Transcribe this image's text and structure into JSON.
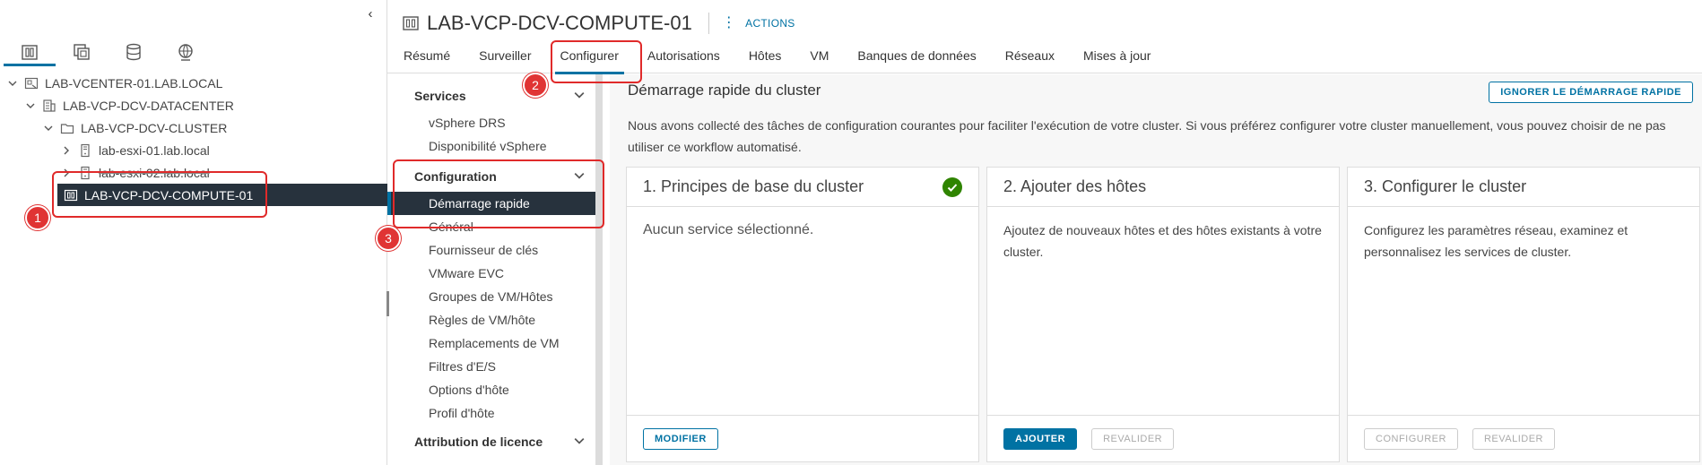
{
  "navigator": {
    "collapse_glyph": "‹",
    "view_tabs": [
      {
        "icon": "hosts-clusters-icon"
      },
      {
        "icon": "vms-templates-icon"
      },
      {
        "icon": "storage-icon"
      },
      {
        "icon": "networking-icon"
      }
    ],
    "tree": [
      {
        "label": "LAB-VCENTER-01.LAB.LOCAL",
        "icon": "vcenter-icon",
        "expanded": true
      },
      {
        "label": "LAB-VCP-DCV-DATACENTER",
        "icon": "datacenter-icon",
        "expanded": true
      },
      {
        "label": "LAB-VCP-DCV-CLUSTER",
        "icon": "folder-icon",
        "expanded": true
      },
      {
        "label": "lab-esxi-01.lab.local",
        "icon": "host-icon",
        "expanded": false
      },
      {
        "label": "lab-esxi-02.lab.local",
        "icon": "host-icon",
        "expanded": false
      },
      {
        "label": "LAB-VCP-DCV-COMPUTE-01",
        "icon": "cluster-icon",
        "selected": true
      }
    ]
  },
  "annotations": {
    "m1": "1",
    "m2": "2",
    "m3": "3"
  },
  "header": {
    "title": "LAB-VCP-DCV-COMPUTE-01",
    "actions_label": "ACTIONS",
    "tabs": [
      "Résumé",
      "Surveiller",
      "Configurer",
      "Autorisations",
      "Hôtes",
      "VM",
      "Banques de données",
      "Réseaux",
      "Mises à jour"
    ],
    "active_tab": "Configurer"
  },
  "subnav": {
    "services": {
      "title": "Services",
      "items": [
        "vSphere DRS",
        "Disponibilité vSphere"
      ]
    },
    "configuration": {
      "title": "Configuration",
      "items": [
        "Démarrage rapide",
        "Général",
        "Fournisseur de clés",
        "VMware EVC",
        "Groupes de VM/Hôtes",
        "Règles de VM/hôte",
        "Remplacements de VM",
        "Filtres d'E/S",
        "Options d'hôte",
        "Profil d'hôte"
      ]
    },
    "licensing": {
      "title": "Attribution de licence"
    }
  },
  "main": {
    "title": "Démarrage rapide du cluster",
    "ignore_button": "IGNORER LE DÉMARRAGE RAPIDE",
    "description": "Nous avons collecté des tâches de configuration courantes pour faciliter l'exécution de votre cluster. Si vous préférez configurer votre cluster manuellement, vous pouvez choisir de ne pas utiliser ce workflow automatisé.",
    "cards": [
      {
        "title": "1. Principes de base du cluster",
        "body": "Aucun service sélectionné.",
        "done": true,
        "buttons": [
          "MODIFIER"
        ]
      },
      {
        "title": "2. Ajouter des hôtes",
        "body": "Ajoutez de nouveaux hôtes et des hôtes existants à votre cluster.",
        "buttons": [
          "AJOUTER",
          "REVALIDER"
        ]
      },
      {
        "title": "3. Configurer le cluster",
        "body": "Configurez les paramètres réseau, examinez et personnalisez les services de cluster.",
        "buttons": [
          "CONFIGURER",
          "REVALIDER"
        ]
      }
    ]
  }
}
